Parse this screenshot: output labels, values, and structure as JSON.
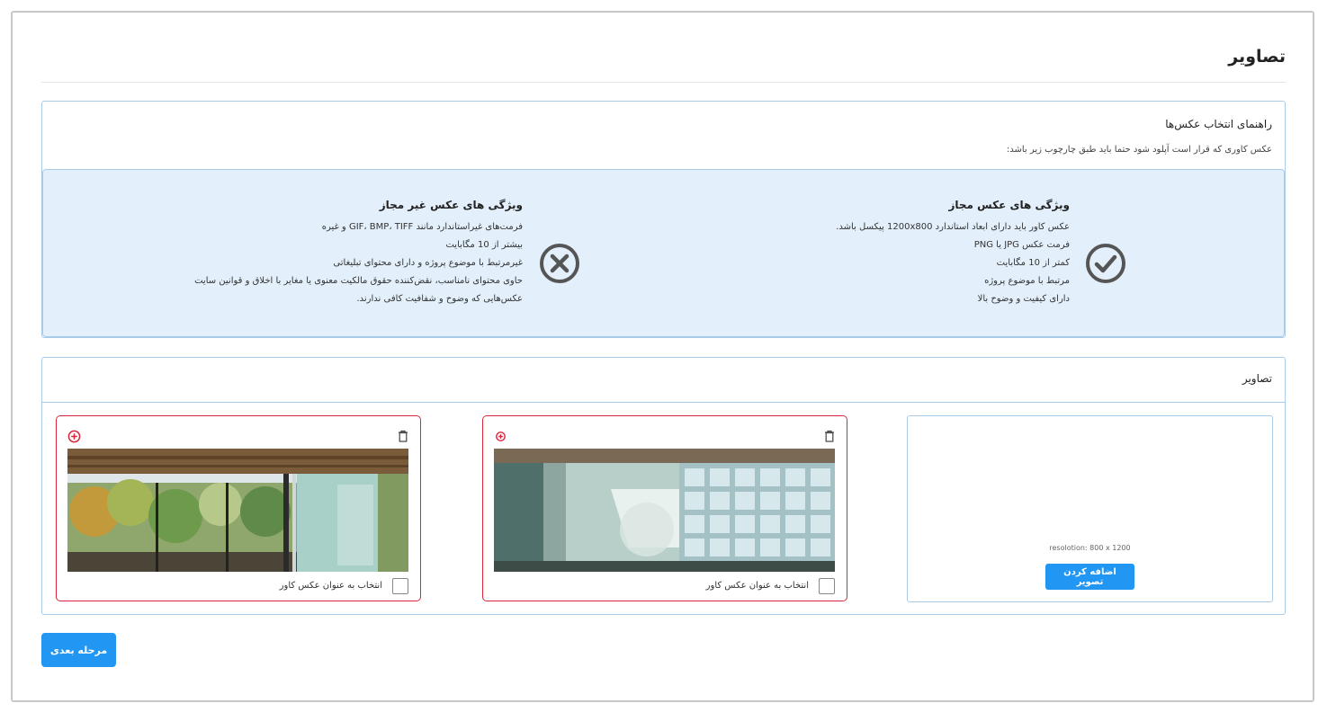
{
  "page": {
    "title": "تصاویر"
  },
  "guide": {
    "title": "راهنمای انتخاب عکس‌ها",
    "description": "عکس کاوری که قرار است آپلود شود حتما باید طبق چارچوب زیر باشد:",
    "allowed": {
      "title": "ویژگی های عکس مجاز",
      "items": [
        "عکس کاور باید دارای ابعاد استاندارد 1200x800 پیکسل باشد.",
        "فرمت عکس JPG یا PNG",
        "کمتر از 10 مگابایت",
        "مرتبط با موضوع پروژه",
        "دارای کیفیت و وضوح بالا"
      ],
      "icon": "check-circle-icon"
    },
    "forbidden": {
      "title": "ویژگی های عکس غیر مجاز",
      "items": [
        "فرمت‌های غیراستاندارد مانند GIF، BMP، TIFF و غیره",
        "بیشتر از 10 مگابایت",
        "غیرمرتبط با موضوع پروژه و دارای محتوای تبلیغاتی",
        "حاوی محتوای نامناسب، نقض‌کننده حقوق مالکیت معنوی یا مغایر با اخلاق و قوانین سایت",
        "عکس‌هایی که وضوح و شفافیت کافی ندارند."
      ],
      "icon": "x-circle-icon"
    }
  },
  "images": {
    "title": "تصاویر",
    "upload": {
      "resolution": "resolotion: 800 x 1200",
      "button": "اضافه کردن تصویر"
    },
    "cards": [
      {
        "label": "انتخاب به عنوان عکس کاور",
        "photo": "glass-wall-interior",
        "checked": false
      },
      {
        "label": "انتخاب به عنوان عکس کاور",
        "photo": "forest-view-windows",
        "checked": false
      }
    ]
  },
  "footer": {
    "next_button": "مرحله بعدی"
  },
  "colors": {
    "primary": "#2196f3",
    "danger": "#d9253b",
    "panel_border": "#a9cbea",
    "info_bg": "#e3f0fc"
  }
}
